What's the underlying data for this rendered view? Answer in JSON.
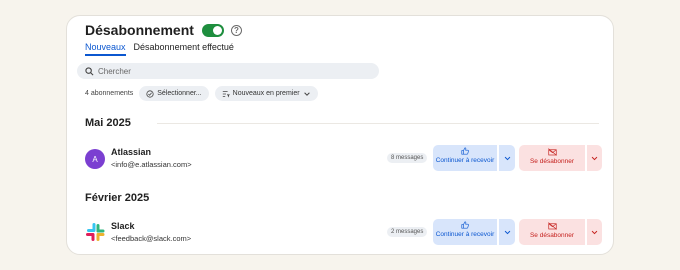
{
  "header": {
    "title": "Désabonnement",
    "toggle_on": true,
    "help_glyph": "?"
  },
  "tabs": [
    {
      "label": "Nouveaux",
      "active": true
    },
    {
      "label": "Désabonnement effectué",
      "active": false
    }
  ],
  "search": {
    "placeholder": "Chercher",
    "value": ""
  },
  "toolbar": {
    "count": "4 abonnements",
    "select_label": "Sélectionner...",
    "sort_label": "Nouveaux en premier"
  },
  "sections": [
    {
      "title": "Mai 2025",
      "senders": [
        {
          "avatar_letter": "A",
          "avatar_color": "#7b3fd1",
          "name": "Atlassian",
          "email": "<info@e.atlassian.com>",
          "message_count": "8 messages",
          "continue_label": "Continuer à recevoir",
          "unsubscribe_label": "Se désabonner"
        }
      ]
    },
    {
      "title": "Février 2025",
      "senders": [
        {
          "logo": "slack-logo",
          "name": "Slack",
          "email": "<feedback@slack.com>",
          "message_count": "2 messages",
          "continue_label": "Continuer à recevoir",
          "unsubscribe_label": "Se désabonner"
        }
      ]
    }
  ],
  "colors": {
    "accent": "#0b57d0",
    "toggle": "#1e8e3e",
    "danger": "#c5221f",
    "continue_bg": "#d8e5fb",
    "unsubscribe_bg": "#fbe1e1"
  }
}
